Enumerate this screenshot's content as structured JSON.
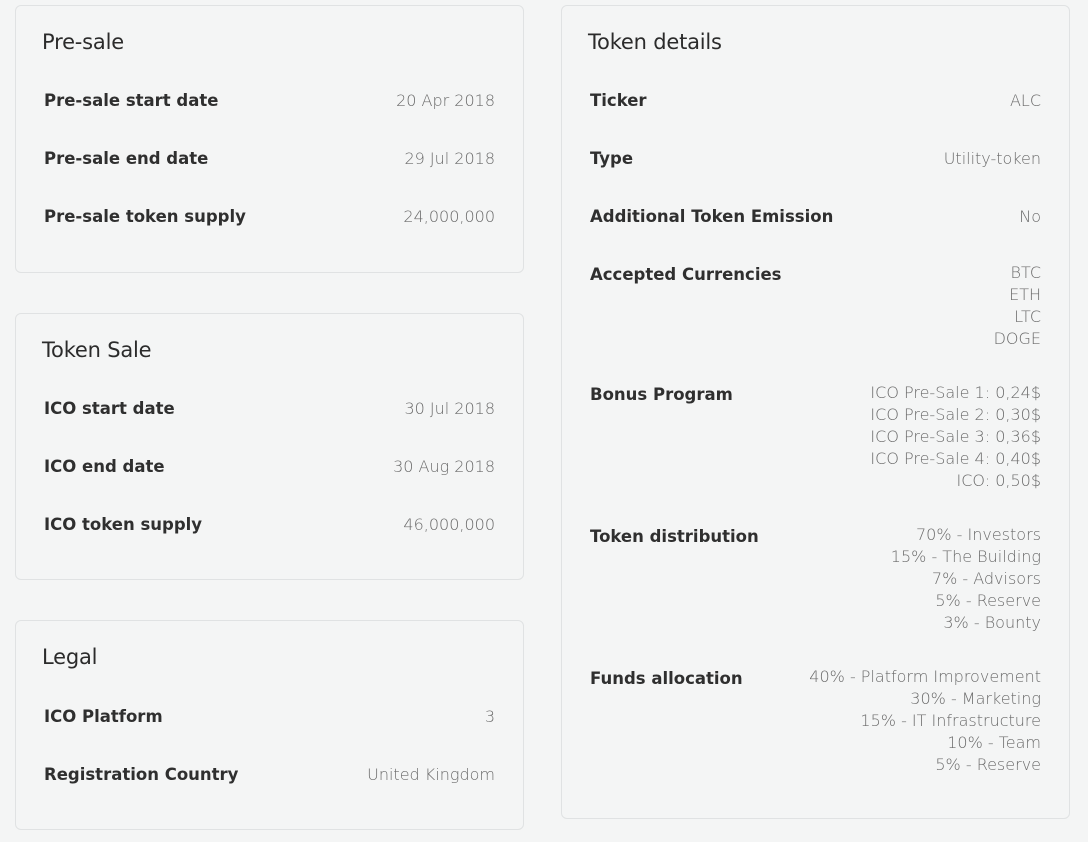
{
  "presale": {
    "title": "Pre-sale",
    "rows": [
      {
        "label": "Pre-sale start date",
        "value": "20 Apr 2018"
      },
      {
        "label": "Pre-sale end date",
        "value": "29 Jul 2018"
      },
      {
        "label": "Pre-sale token supply",
        "value": "24,000,000"
      }
    ]
  },
  "token_sale": {
    "title": "Token Sale",
    "rows": [
      {
        "label": "ICO start date",
        "value": "30 Jul 2018"
      },
      {
        "label": "ICO end date",
        "value": "30 Aug 2018"
      },
      {
        "label": "ICO token supply",
        "value": "46,000,000"
      }
    ]
  },
  "legal": {
    "title": "Legal",
    "rows": [
      {
        "label": "ICO Platform",
        "value": "3"
      },
      {
        "label": "Registration Country",
        "value": "United Kingdom"
      }
    ]
  },
  "token_details": {
    "title": "Token details",
    "ticker": {
      "label": "Ticker",
      "value": "ALC"
    },
    "type": {
      "label": "Type",
      "value": "Utility-token"
    },
    "emission": {
      "label": "Additional Token Emission",
      "value": "No"
    },
    "currencies": {
      "label": "Accepted Currencies",
      "values": [
        "BTC",
        "ETH",
        "LTC",
        "DOGE"
      ]
    },
    "bonus": {
      "label": "Bonus Program",
      "values": [
        "ICO Pre-Sale 1: 0,24$",
        "ICO Pre-Sale 2: 0,30$",
        "ICO Pre-Sale 3: 0,36$",
        "ICO Pre-Sale 4: 0,40$",
        "ICO: 0,50$"
      ]
    },
    "distribution": {
      "label": "Token distribution",
      "values": [
        "70% - Investors",
        "15% - The Building",
        "7% - Advisors",
        "5% - Reserve",
        "3% - Bounty"
      ]
    },
    "funds": {
      "label": "Funds allocation",
      "values": [
        "40% - Platform Improvement",
        "30% - Marketing",
        "15% - IT Infrastructure",
        "10% - Team",
        "5% - Reserve"
      ]
    }
  }
}
